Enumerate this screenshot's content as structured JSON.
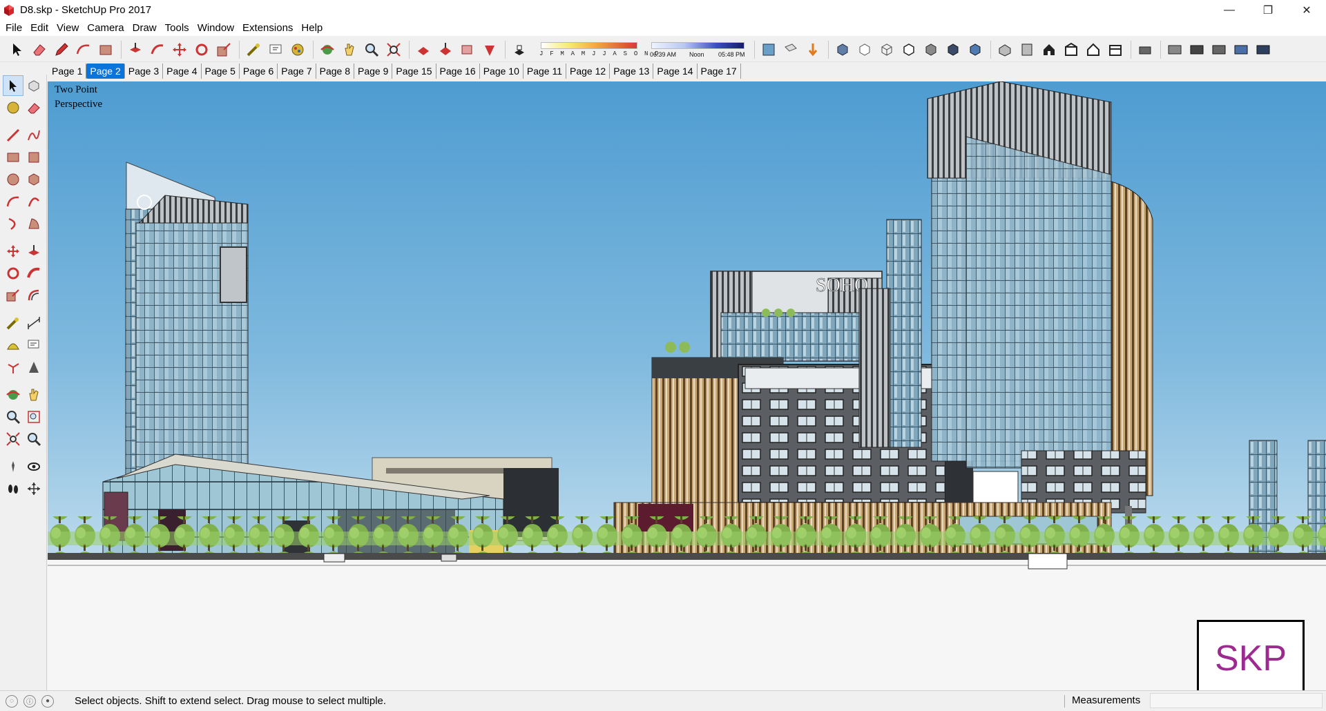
{
  "window": {
    "title": "D8.skp - SketchUp Pro 2017"
  },
  "window_controls": {
    "minimize": "—",
    "restore": "❐",
    "close": "✕"
  },
  "menu": [
    "File",
    "Edit",
    "View",
    "Camera",
    "Draw",
    "Tools",
    "Window",
    "Extensions",
    "Help"
  ],
  "toolbar": {
    "shadow_months": "J F M A M J J A S O N D",
    "time_start": "06:39 AM",
    "time_noon": "Noon",
    "time_end": "05:48 PM"
  },
  "tabs": [
    "Page 1",
    "Page 2",
    "Page 3",
    "Page 4",
    "Page 5",
    "Page 6",
    "Page 7",
    "Page 8",
    "Page 9",
    "Page 15",
    "Page 16",
    "Page 10",
    "Page 11",
    "Page 12",
    "Page 13",
    "Page 14",
    "Page 17"
  ],
  "active_tab": "Page 2",
  "viewport": {
    "camera_line1": "Two Point",
    "camera_line2": "Perspective",
    "sign_text": "SOHO",
    "logo_text": "SKP"
  },
  "status": {
    "message": "Select objects. Shift to extend select. Drag mouse to select multiple.",
    "measurements_label": "Measurements",
    "measurements_value": ""
  },
  "colors": {
    "accent": "#0a74da",
    "sky_top": "#4e9cd1",
    "sky_bottom": "#e6f1f7",
    "logo": "#9c2a90"
  }
}
